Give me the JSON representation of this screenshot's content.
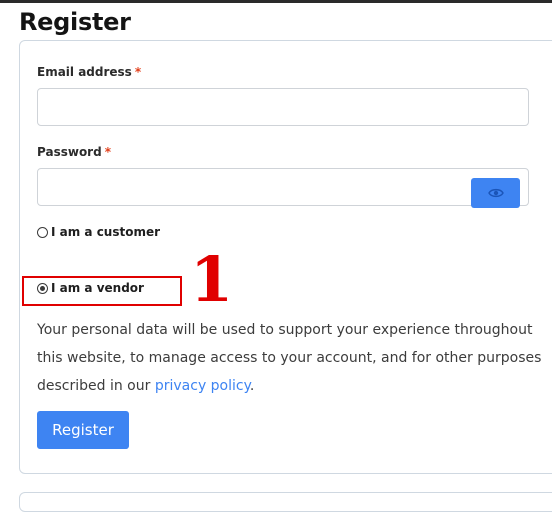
{
  "page": {
    "title": "Register"
  },
  "form": {
    "email": {
      "label": "Email address",
      "required_mark": "*",
      "value": "",
      "placeholder": ""
    },
    "password": {
      "label": "Password",
      "required_mark": "*",
      "value": "",
      "placeholder": "",
      "toggle_icon": "eye-icon"
    },
    "roles": [
      {
        "label": "I am a customer",
        "checked": false
      },
      {
        "label": "I am a vendor",
        "checked": true
      }
    ],
    "privacy_text": "Your personal data will be used to support your experience throughout this website, to manage access to your account, and for other purposes described in our ",
    "privacy_link": "privacy policy",
    "privacy_end": ".",
    "submit_label": "Register"
  },
  "annotation": {
    "marker": "1",
    "color": "#e00000"
  },
  "colors": {
    "accent": "#3e84f2",
    "required": "#e2401c"
  }
}
